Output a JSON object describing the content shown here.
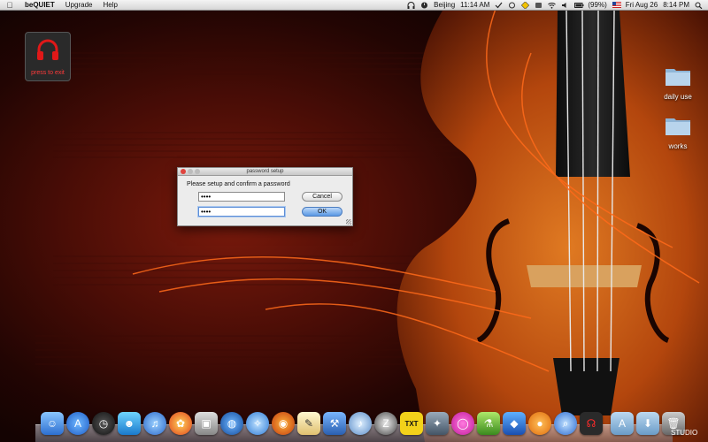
{
  "menubar": {
    "apple": "",
    "app_name": "beQUIET",
    "menus": [
      "Upgrade",
      "Help"
    ],
    "city": "Beijing",
    "time_left": "11:14 AM",
    "battery": "(99%)",
    "date": "Fri Aug 26",
    "time_right": "8:14 PM"
  },
  "desktop": {
    "exit_label": "press to exit",
    "folders": [
      {
        "label": "daily use"
      },
      {
        "label": "works"
      }
    ]
  },
  "dialog": {
    "title": "password setup",
    "prompt": "Please setup and confirm a password",
    "password_value": "••••",
    "confirm_value": "••••",
    "cancel_label": "Cancel",
    "ok_label": "OK"
  },
  "dock": {
    "items": [
      "finder",
      "app-store",
      "dashboard",
      "ichat",
      "itunes",
      "photo",
      "preview",
      "earth",
      "safari",
      "firefox",
      "textedit",
      "xcode",
      "itunes2",
      "zend",
      "txt",
      "bird",
      "lasso",
      "vial",
      "app-blue",
      "app-orange",
      "magnifier",
      "headphones"
    ],
    "trailing_text": "STUDIO"
  },
  "colors": {
    "accent_red": "#ff3a3a",
    "dialog_bg": "#ececec",
    "ok_blue": "#5a98e4"
  }
}
